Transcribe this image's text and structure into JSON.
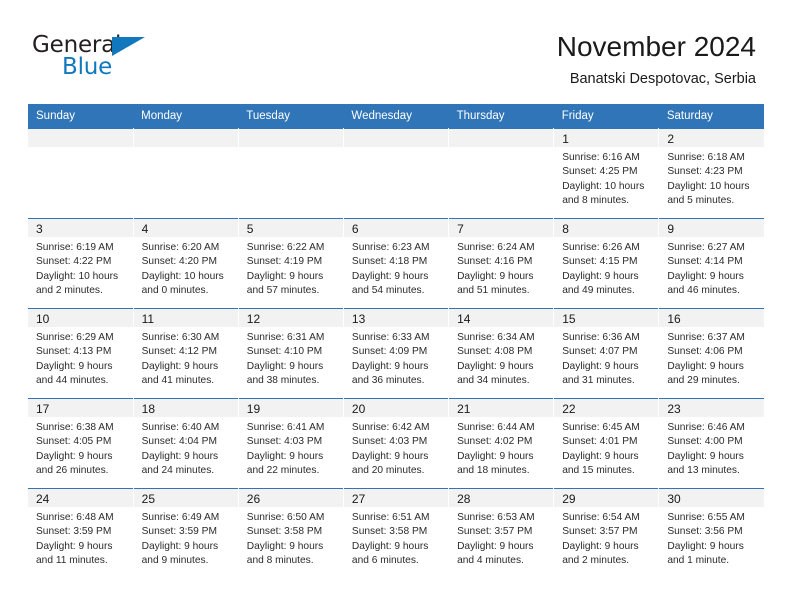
{
  "brand": {
    "word_one": "General",
    "word_two": "Blue",
    "accent_color": "#1278be",
    "triangle_icon": "triangle-icon"
  },
  "header": {
    "title": "November 2024",
    "subtitle": "Banatski Despotovac, Serbia"
  },
  "theme": {
    "header_blue": "#3075b8",
    "daynum_grey": "#f2f2f2"
  },
  "weekdays": [
    "Sunday",
    "Monday",
    "Tuesday",
    "Wednesday",
    "Thursday",
    "Friday",
    "Saturday"
  ],
  "weeks": [
    [
      {
        "day": "",
        "lines": []
      },
      {
        "day": "",
        "lines": []
      },
      {
        "day": "",
        "lines": []
      },
      {
        "day": "",
        "lines": []
      },
      {
        "day": "",
        "lines": []
      },
      {
        "day": "1",
        "lines": [
          "Sunrise: 6:16 AM",
          "Sunset: 4:25 PM",
          "Daylight: 10 hours",
          "and 8 minutes."
        ]
      },
      {
        "day": "2",
        "lines": [
          "Sunrise: 6:18 AM",
          "Sunset: 4:23 PM",
          "Daylight: 10 hours",
          "and 5 minutes."
        ]
      }
    ],
    [
      {
        "day": "3",
        "lines": [
          "Sunrise: 6:19 AM",
          "Sunset: 4:22 PM",
          "Daylight: 10 hours",
          "and 2 minutes."
        ]
      },
      {
        "day": "4",
        "lines": [
          "Sunrise: 6:20 AM",
          "Sunset: 4:20 PM",
          "Daylight: 10 hours",
          "and 0 minutes."
        ]
      },
      {
        "day": "5",
        "lines": [
          "Sunrise: 6:22 AM",
          "Sunset: 4:19 PM",
          "Daylight: 9 hours",
          "and 57 minutes."
        ]
      },
      {
        "day": "6",
        "lines": [
          "Sunrise: 6:23 AM",
          "Sunset: 4:18 PM",
          "Daylight: 9 hours",
          "and 54 minutes."
        ]
      },
      {
        "day": "7",
        "lines": [
          "Sunrise: 6:24 AM",
          "Sunset: 4:16 PM",
          "Daylight: 9 hours",
          "and 51 minutes."
        ]
      },
      {
        "day": "8",
        "lines": [
          "Sunrise: 6:26 AM",
          "Sunset: 4:15 PM",
          "Daylight: 9 hours",
          "and 49 minutes."
        ]
      },
      {
        "day": "9",
        "lines": [
          "Sunrise: 6:27 AM",
          "Sunset: 4:14 PM",
          "Daylight: 9 hours",
          "and 46 minutes."
        ]
      }
    ],
    [
      {
        "day": "10",
        "lines": [
          "Sunrise: 6:29 AM",
          "Sunset: 4:13 PM",
          "Daylight: 9 hours",
          "and 44 minutes."
        ]
      },
      {
        "day": "11",
        "lines": [
          "Sunrise: 6:30 AM",
          "Sunset: 4:12 PM",
          "Daylight: 9 hours",
          "and 41 minutes."
        ]
      },
      {
        "day": "12",
        "lines": [
          "Sunrise: 6:31 AM",
          "Sunset: 4:10 PM",
          "Daylight: 9 hours",
          "and 38 minutes."
        ]
      },
      {
        "day": "13",
        "lines": [
          "Sunrise: 6:33 AM",
          "Sunset: 4:09 PM",
          "Daylight: 9 hours",
          "and 36 minutes."
        ]
      },
      {
        "day": "14",
        "lines": [
          "Sunrise: 6:34 AM",
          "Sunset: 4:08 PM",
          "Daylight: 9 hours",
          "and 34 minutes."
        ]
      },
      {
        "day": "15",
        "lines": [
          "Sunrise: 6:36 AM",
          "Sunset: 4:07 PM",
          "Daylight: 9 hours",
          "and 31 minutes."
        ]
      },
      {
        "day": "16",
        "lines": [
          "Sunrise: 6:37 AM",
          "Sunset: 4:06 PM",
          "Daylight: 9 hours",
          "and 29 minutes."
        ]
      }
    ],
    [
      {
        "day": "17",
        "lines": [
          "Sunrise: 6:38 AM",
          "Sunset: 4:05 PM",
          "Daylight: 9 hours",
          "and 26 minutes."
        ]
      },
      {
        "day": "18",
        "lines": [
          "Sunrise: 6:40 AM",
          "Sunset: 4:04 PM",
          "Daylight: 9 hours",
          "and 24 minutes."
        ]
      },
      {
        "day": "19",
        "lines": [
          "Sunrise: 6:41 AM",
          "Sunset: 4:03 PM",
          "Daylight: 9 hours",
          "and 22 minutes."
        ]
      },
      {
        "day": "20",
        "lines": [
          "Sunrise: 6:42 AM",
          "Sunset: 4:03 PM",
          "Daylight: 9 hours",
          "and 20 minutes."
        ]
      },
      {
        "day": "21",
        "lines": [
          "Sunrise: 6:44 AM",
          "Sunset: 4:02 PM",
          "Daylight: 9 hours",
          "and 18 minutes."
        ]
      },
      {
        "day": "22",
        "lines": [
          "Sunrise: 6:45 AM",
          "Sunset: 4:01 PM",
          "Daylight: 9 hours",
          "and 15 minutes."
        ]
      },
      {
        "day": "23",
        "lines": [
          "Sunrise: 6:46 AM",
          "Sunset: 4:00 PM",
          "Daylight: 9 hours",
          "and 13 minutes."
        ]
      }
    ],
    [
      {
        "day": "24",
        "lines": [
          "Sunrise: 6:48 AM",
          "Sunset: 3:59 PM",
          "Daylight: 9 hours",
          "and 11 minutes."
        ]
      },
      {
        "day": "25",
        "lines": [
          "Sunrise: 6:49 AM",
          "Sunset: 3:59 PM",
          "Daylight: 9 hours",
          "and 9 minutes."
        ]
      },
      {
        "day": "26",
        "lines": [
          "Sunrise: 6:50 AM",
          "Sunset: 3:58 PM",
          "Daylight: 9 hours",
          "and 8 minutes."
        ]
      },
      {
        "day": "27",
        "lines": [
          "Sunrise: 6:51 AM",
          "Sunset: 3:58 PM",
          "Daylight: 9 hours",
          "and 6 minutes."
        ]
      },
      {
        "day": "28",
        "lines": [
          "Sunrise: 6:53 AM",
          "Sunset: 3:57 PM",
          "Daylight: 9 hours",
          "and 4 minutes."
        ]
      },
      {
        "day": "29",
        "lines": [
          "Sunrise: 6:54 AM",
          "Sunset: 3:57 PM",
          "Daylight: 9 hours",
          "and 2 minutes."
        ]
      },
      {
        "day": "30",
        "lines": [
          "Sunrise: 6:55 AM",
          "Sunset: 3:56 PM",
          "Daylight: 9 hours",
          "and 1 minute."
        ]
      }
    ]
  ]
}
